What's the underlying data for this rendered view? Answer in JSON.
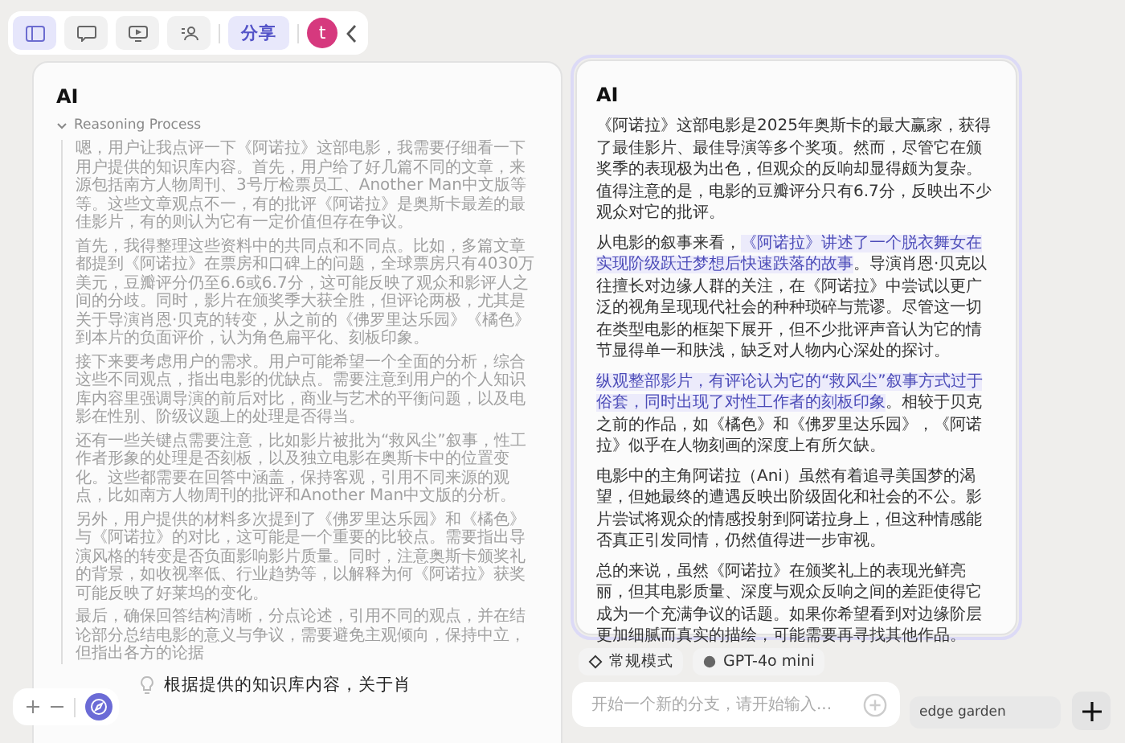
{
  "toolbar": {
    "buttons": [
      {
        "kind": "sidebar",
        "selected": true
      },
      {
        "kind": "chat",
        "selected": false
      },
      {
        "kind": "screen",
        "selected": false
      },
      {
        "kind": "people",
        "selected": false
      }
    ],
    "share": "分享",
    "avatar": "t"
  },
  "left_card": {
    "title": "AI",
    "reasoning": {
      "label": "Reasoning Process",
      "expanded": true,
      "paragraphs": [
        "嗯，用户让我点评一下《阿诺拉》这部电影，我需要仔细看一下用户提供的知识库内容。首先，用户给了好几篇不同的文章，来源包括南方人物周刊、3号厅检票员工、Another Man中文版等等。这些文章观点不一，有的批评《阿诺拉》是奥斯卡最差的最佳影片，有的则认为它有一定价值但存在争议。",
        "首先，我得整理这些资料中的共同点和不同点。比如，多篇文章都提到《阿诺拉》在票房和口碑上的问题，全球票房只有4030万美元，豆瓣评分仍至6.6或6.7分，这可能反映了观众和影评人之间的分歧。同时，影片在颁奖季大获全胜，但评论两极，尤其是关于导演肖恩·贝克的转变，从之前的《佛罗里达乐园》《橘色》到本片的负面评价，认为角色扁平化、刻板印象。",
        "接下来要考虑用户的需求。用户可能希望一个全面的分析，综合这些不同观点，指出电影的优缺点。需要注意到用户的个人知识库内容里强调导演的前后对比，商业与艺术的平衡问题，以及电影在性别、阶级议题上的处理是否得当。",
        "还有一些关键点需要注意，比如影片被批为“救风尘”叙事，性工作者形象的处理是否刻板，以及独立电影在奥斯卡中的位置变化。这些都需要在回答中涵盖，保持客观，引用不同来源的观点，比如南方人物周刊的批评和Another Man中文版的分析。",
        "另外，用户提供的材料多次提到了《佛罗里达乐园》和《橘色》与《阿诺拉》的对比，这可能是一个重要的比较点。需要指出导演风格的转变是否负面影响影片质量。同时，注意奥斯卡颁奖礼的背景，如收视率低、行业趋势等，以解释为何《阿诺拉》获奖可能反映了好莱坞的变化。",
        "最后，确保回答结构清晰，分点论述，引用不同的观点，并在结论部分总结电影的意义与争议，需要避免主观倾向，保持中立，但指出各方的论据"
      ]
    },
    "answer": "根据提供的知识库内容，关于肖"
  },
  "right_card": {
    "title": "AI",
    "selected": true,
    "paragraphs": [
      [
        {
          "text": "《阿诺拉》这部电影是2025年奥斯卡的最大赢家，获得了最佳影片、最佳导演等多个奖项。然而，尽管它在颁奖季的表现极为出色，但观众的反响却显得颇为复杂。值得注意的是，电影的豆瓣评分只有6.7分，反映出不少观众对它的批评。",
          "highlighted": false
        }
      ],
      [
        {
          "text": "从电影的叙事来看，",
          "highlighted": false
        },
        {
          "text": "《阿诺拉》讲述了一个脱衣舞女在实现阶级跃迁梦想后快速跌落的故事",
          "highlighted": true
        },
        {
          "text": "。导演肖恩·贝克以往擅长对边缘人群的关注，在《阿诺拉》中尝试以更广泛的视角呈现现代社会的种种琐碎与荒谬。尽管这一切在类型电影的框架下展开，但不少批评声音认为它的情节显得单一和肤浅，缺乏对人物内心深处的探讨。",
          "highlighted": false
        }
      ],
      [
        {
          "text": "纵观整部影片，有评论认为它的“救风尘”叙事方式过于俗套，同时出现了对性工作者的刻板印象",
          "highlighted": true
        },
        {
          "text": "。相较于贝克之前的作品，如《橘色》和《佛罗里达乐园》，《阿诺拉》似乎在人物刻画的深度上有所欠缺。",
          "highlighted": false
        }
      ],
      [
        {
          "text": "电影中的主角阿诺拉（Ani）虽然有着追寻美国梦的渴望，但她最终的遭遇反映出阶级固化和社会的不公。影片尝试将观众的情感投射到阿诺拉身上，但这种情感能否真正引发同情，仍然值得进一步审视。",
          "highlighted": false
        }
      ],
      [
        {
          "text": "总的来说，虽然《阿诺拉》在颁奖礼上的表现光鲜亮丽，但其电影质量、深度与观众反响之间的差距使得它成为一个充满争议的话题。如果你希望看到对边缘阶层更加细腻而真实的描绘，可能需要再寻找其他作品。",
          "highlighted": false
        }
      ]
    ]
  },
  "composer": {
    "modes": [
      {
        "kind": "mode",
        "label": "常规模式"
      },
      {
        "kind": "model",
        "label": "GPT-4o mini"
      }
    ],
    "placeholder": "开始一个新的分支，请开始输入..."
  },
  "source_chip": "edge garden"
}
